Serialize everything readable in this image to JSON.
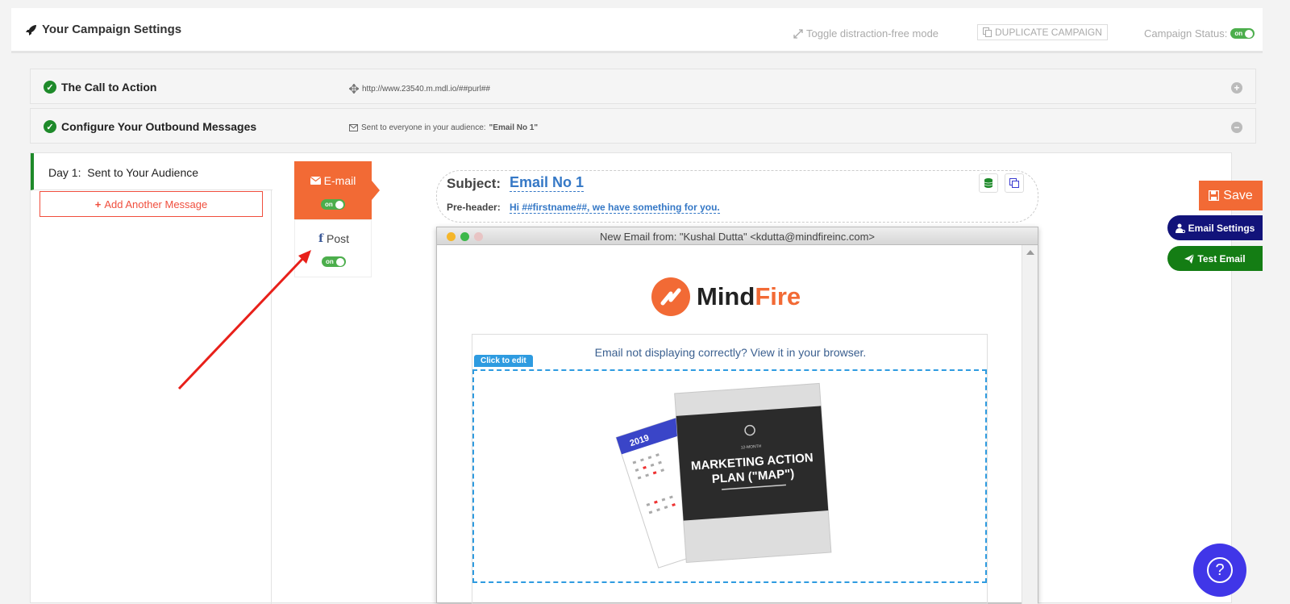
{
  "header": {
    "title": "Your Campaign Settings",
    "distraction_toggle": "Toggle distraction-free mode",
    "duplicate": "DUPLICATE CAMPAIGN",
    "status_label": "Campaign Status:",
    "status_toggle": "on"
  },
  "sections": [
    {
      "title": "The Call to Action",
      "info": "http://www.23540.m.mdl.io/##purl##",
      "state": "collapsed"
    },
    {
      "title": "Configure Your Outbound Messages",
      "info_prefix": "Sent to everyone in your audience: ",
      "info_bold": "\"Email No 1\"",
      "state": "expanded"
    }
  ],
  "day": {
    "label": "Day 1:",
    "text": "Sent to Your Audience"
  },
  "add_message": "Add Another Message",
  "channels": {
    "email": {
      "label": "E-mail",
      "toggle": "on"
    },
    "post": {
      "label": "Post",
      "toggle": "on"
    }
  },
  "subject": {
    "label": "Subject:",
    "value": "Email No 1",
    "preheader_label": "Pre-header:",
    "preheader_value": "Hi ##firstname##, we have something for you."
  },
  "preview": {
    "window_title": "New Email from: \"Kushal Dutta\" <kdutta@mindfireinc.com>",
    "logo_text_1": "Mind",
    "logo_text_2": "Fire",
    "view_link": "Email not displaying correctly? View it in your browser.",
    "click_to_edit": "Click to edit",
    "book_year": "2019",
    "book_small": "12-MONTH",
    "book_title_1": "MARKETING ACTION",
    "book_title_2": "PLAN (\"MAP\")"
  },
  "actions": {
    "save": "Save",
    "email_settings": "Email Settings",
    "test_email": "Test Email"
  },
  "colors": {
    "accent_orange": "#f26a35",
    "success_green": "#1e8a2a",
    "link_blue": "#3578c6",
    "navy": "#12137a",
    "help_purple": "#4036e8",
    "annotation_red": "#e8201a"
  }
}
